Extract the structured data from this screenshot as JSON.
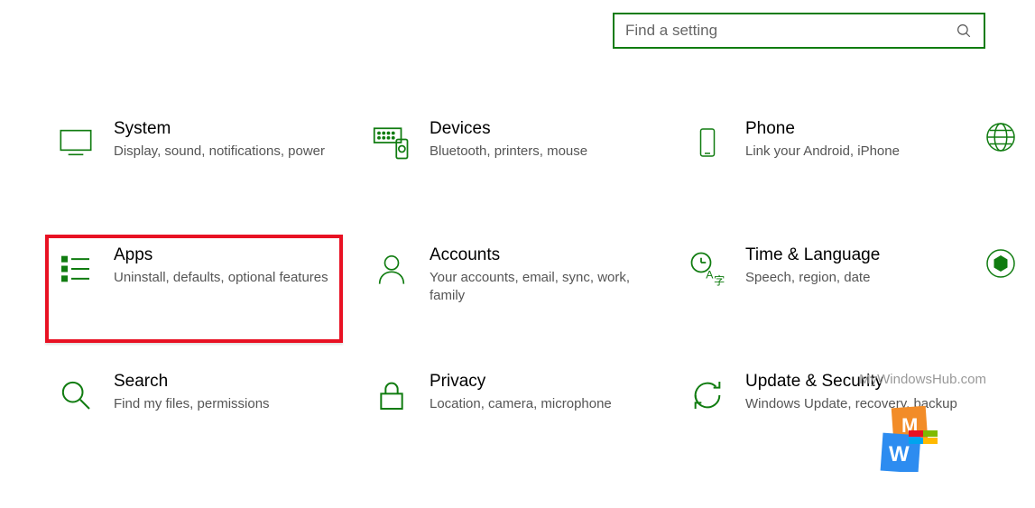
{
  "search": {
    "placeholder": "Find a setting"
  },
  "tiles": [
    {
      "title": "System",
      "subtitle": "Display, sound, notifications, power",
      "highlighted": false
    },
    {
      "title": "Devices",
      "subtitle": "Bluetooth, printers, mouse",
      "highlighted": false
    },
    {
      "title": "Phone",
      "subtitle": "Link your Android, iPhone",
      "highlighted": false
    },
    {
      "title": "Apps",
      "subtitle": "Uninstall, defaults, optional features",
      "highlighted": true
    },
    {
      "title": "Accounts",
      "subtitle": "Your accounts, email, sync, work, family",
      "highlighted": false
    },
    {
      "title": "Time & Language",
      "subtitle": "Speech, region, date",
      "highlighted": false
    },
    {
      "title": "Search",
      "subtitle": "Find my files, permissions",
      "highlighted": false
    },
    {
      "title": "Privacy",
      "subtitle": "Location, camera, microphone",
      "highlighted": false
    },
    {
      "title": "Update & Security",
      "subtitle": "Windows Update, recovery, backup",
      "highlighted": false
    }
  ],
  "edge_icons": [
    "network-internet-icon",
    "gaming-icon"
  ],
  "watermark": "MyWindowsHub.com",
  "colors": {
    "accent": "#107C10",
    "highlight_border": "#E81123"
  }
}
